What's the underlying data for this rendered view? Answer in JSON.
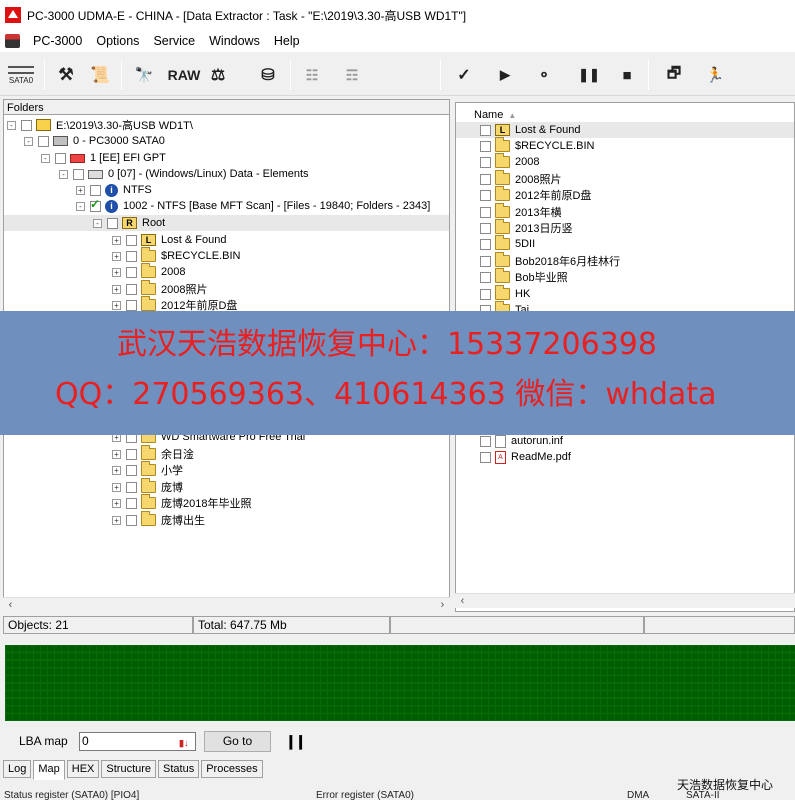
{
  "window": {
    "title": "PC-3000 UDMA-E - CHINA - [Data Extractor : Task - \"E:\\2019\\3.30-高USB WD1T\"]"
  },
  "menu": {
    "items": [
      "PC-3000",
      "Options",
      "Service",
      "Windows",
      "Help"
    ]
  },
  "toolbar": {
    "sata_label": "SATA0",
    "raw_label": "RAW"
  },
  "folders_panel": {
    "header": "Folders",
    "tree": [
      {
        "label": "E:\\2019\\3.30-高USB WD1T\\",
        "icon": "pc-folder-icon",
        "expander": "-"
      },
      {
        "label": "0 - PC3000 SATA0",
        "icon": "drive-icon",
        "expander": "-"
      },
      {
        "label": "1 [EE] EFI GPT",
        "icon": "partition-icon",
        "expander": "-"
      },
      {
        "label": "0 [07] - (Windows/Linux) Data - Elements",
        "icon": "disk-icon",
        "expander": "-"
      },
      {
        "label": "NTFS",
        "icon": "info-icon",
        "expander": "+"
      },
      {
        "label": "1002 - NTFS [Base MFT Scan] - [Files - 19840; Folders - 2343]",
        "icon": "info-icon",
        "expander": "-",
        "checked": true
      },
      {
        "label": "Root",
        "icon": "root-icon",
        "expander": "-"
      },
      {
        "label": "Lost & Found",
        "icon": "lost-found-icon",
        "expander": "+"
      },
      {
        "label": "$RECYCLE.BIN",
        "icon": "folder-icon",
        "expander": "+"
      },
      {
        "label": "2008",
        "icon": "folder-icon",
        "expander": "+"
      },
      {
        "label": "2008照片",
        "icon": "folder-icon",
        "expander": "+"
      },
      {
        "label": "2012年前原D盘",
        "icon": "folder-icon",
        "expander": "+"
      },
      {
        "label": "WD Smartware Pro Free Trial",
        "icon": "folder-icon",
        "expander": "+"
      },
      {
        "label": "余日淦",
        "icon": "folder-icon",
        "expander": "+"
      },
      {
        "label": "小学",
        "icon": "folder-icon",
        "expander": "+"
      },
      {
        "label": "庞博",
        "icon": "folder-icon",
        "expander": "+"
      },
      {
        "label": "庞博2018年毕业照",
        "icon": "folder-icon",
        "expander": "+"
      },
      {
        "label": "庞博出生",
        "icon": "folder-icon",
        "expander": "+"
      }
    ]
  },
  "files_panel": {
    "column_name": "Name",
    "items": [
      {
        "label": "Lost & Found",
        "icon": "lost-found-icon"
      },
      {
        "label": "$RECYCLE.BIN",
        "icon": "folder-icon"
      },
      {
        "label": "2008",
        "icon": "folder-icon"
      },
      {
        "label": "2008照片",
        "icon": "folder-icon"
      },
      {
        "label": "2012年前原D盘",
        "icon": "folder-icon"
      },
      {
        "label": "2013年横",
        "icon": "folder-icon"
      },
      {
        "label": "2013日历竖",
        "icon": "folder-icon"
      },
      {
        "label": "5DII",
        "icon": "folder-icon"
      },
      {
        "label": "Bob2018年6月桂林行",
        "icon": "folder-icon"
      },
      {
        "label": "Bob毕业照",
        "icon": "folder-icon"
      },
      {
        "label": "HK",
        "icon": "folder-icon"
      },
      {
        "label": "Tai",
        "icon": "folder-icon"
      },
      {
        "label": "autorun.inf",
        "icon": "file-icon"
      },
      {
        "label": "ReadMe.pdf",
        "icon": "pdf-icon"
      }
    ]
  },
  "status": {
    "objects": "Objects: 21",
    "total": "Total: 647.75 Mb"
  },
  "lba": {
    "label": "LBA map",
    "value": "0",
    "goto_label": "Go to"
  },
  "tabs": [
    "Log",
    "Map",
    "HEX",
    "Structure",
    "Status",
    "Processes"
  ],
  "active_tab": "Map",
  "bottom_status": {
    "status_register": "Status register (SATA0) [PIO4]",
    "error_register": "Error register (SATA0)",
    "dma": "DMA",
    "sata": "SATA-II"
  },
  "watermark": {
    "line1": "武汉天浩数据恢复中心：15337206398",
    "line2": "QQ：270569363、410614363   微信：whdata",
    "corner": "天浩数据恢复中心"
  },
  "colors": {
    "map_green": "#22dd22",
    "watermark_bg": "#6f8fbf",
    "watermark_text": "#e82020"
  }
}
